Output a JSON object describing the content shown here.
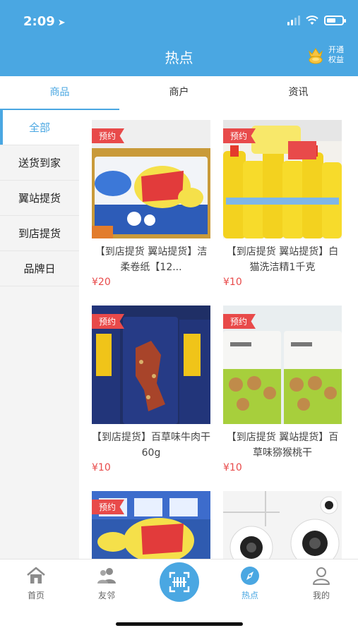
{
  "status_bar": {
    "time": "2:09"
  },
  "header": {
    "title": "热点",
    "vip_label_line1": "开通",
    "vip_label_line2": "权益"
  },
  "tabs": [
    {
      "label": "商品",
      "active": true
    },
    {
      "label": "商户",
      "active": false
    },
    {
      "label": "资讯",
      "active": false
    }
  ],
  "sidebar": {
    "items": [
      {
        "label": "全部",
        "active": true
      },
      {
        "label": "送货到家",
        "active": false
      },
      {
        "label": "翼站提货",
        "active": false
      },
      {
        "label": "到店提货",
        "active": false
      },
      {
        "label": "品牌日",
        "active": false
      }
    ]
  },
  "products": [
    {
      "badge": "预约",
      "name": "【到店提货 翼站提货】洁柔卷纸【12...",
      "price": "¥20"
    },
    {
      "badge": "预约",
      "name": "【到店提货 翼站提货】白猫洗洁精1千克",
      "price": "¥10"
    },
    {
      "badge": "预约",
      "name": "【到店提货】百草味牛肉干60g",
      "price": "¥10"
    },
    {
      "badge": "预约",
      "name": "【到店提货 翼站提货】百草味猕猴桃干",
      "price": "¥10"
    },
    {
      "badge": "预约",
      "name": "",
      "price": ""
    },
    {
      "badge": "",
      "name": "",
      "price": ""
    }
  ],
  "bottom_nav": {
    "items": [
      {
        "label": "首页",
        "icon": "home-icon",
        "active": false
      },
      {
        "label": "友邻",
        "icon": "neighbors-icon",
        "active": false
      },
      {
        "label": "热点",
        "icon": "compass-icon",
        "active": true
      },
      {
        "label": "我的",
        "icon": "profile-icon",
        "active": false
      }
    ],
    "center_icon": "scan-icon"
  },
  "colors": {
    "brand_blue": "#4aa7e2",
    "price_red": "#e84a4a",
    "badge_red": "#e84a4a"
  }
}
